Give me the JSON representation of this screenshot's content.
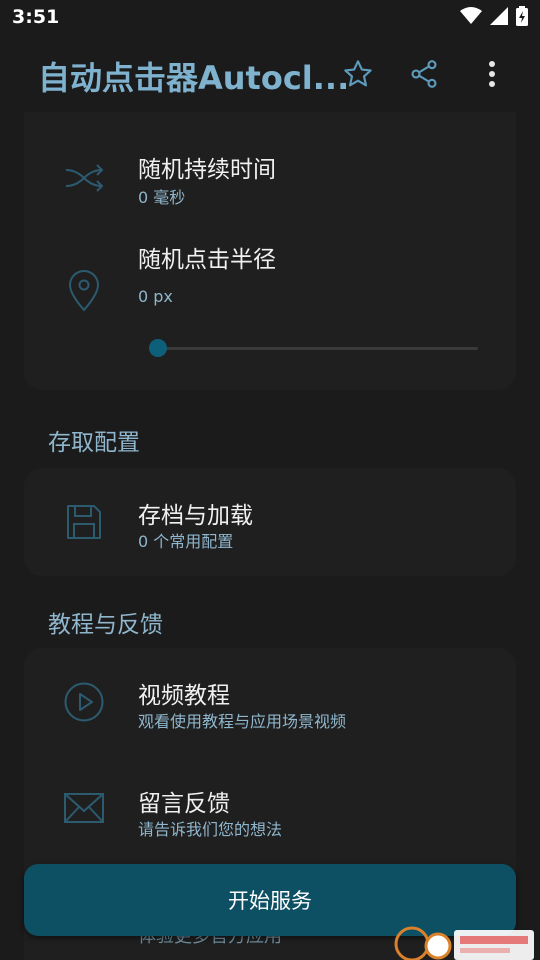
{
  "status": {
    "time": "3:51"
  },
  "app_bar": {
    "title": "自动点击器Autocl..."
  },
  "card_random": {
    "duration": {
      "title": "随机持续时间",
      "value": "0 毫秒"
    },
    "radius": {
      "title": "随机点击半径",
      "value": "0 px",
      "slider_fraction": 0.0
    }
  },
  "section_config": {
    "title": "存取配置"
  },
  "card_config": {
    "save_load": {
      "title": "存档与加载",
      "subtitle": "0 个常用配置"
    }
  },
  "section_tutorial": {
    "title": "教程与反馈"
  },
  "card_tutorial": {
    "video": {
      "title": "视频教程",
      "subtitle": "观看使用教程与应用场景视频"
    },
    "feedback": {
      "title": "留言反馈",
      "subtitle": "请告诉我们您的想法"
    },
    "peek": "体验更多官方应用"
  },
  "start_button": {
    "label": "开始服务"
  },
  "colors": {
    "accent": "#7fb2cf",
    "button": "#0d4f63",
    "background": "#1b1b1b"
  }
}
